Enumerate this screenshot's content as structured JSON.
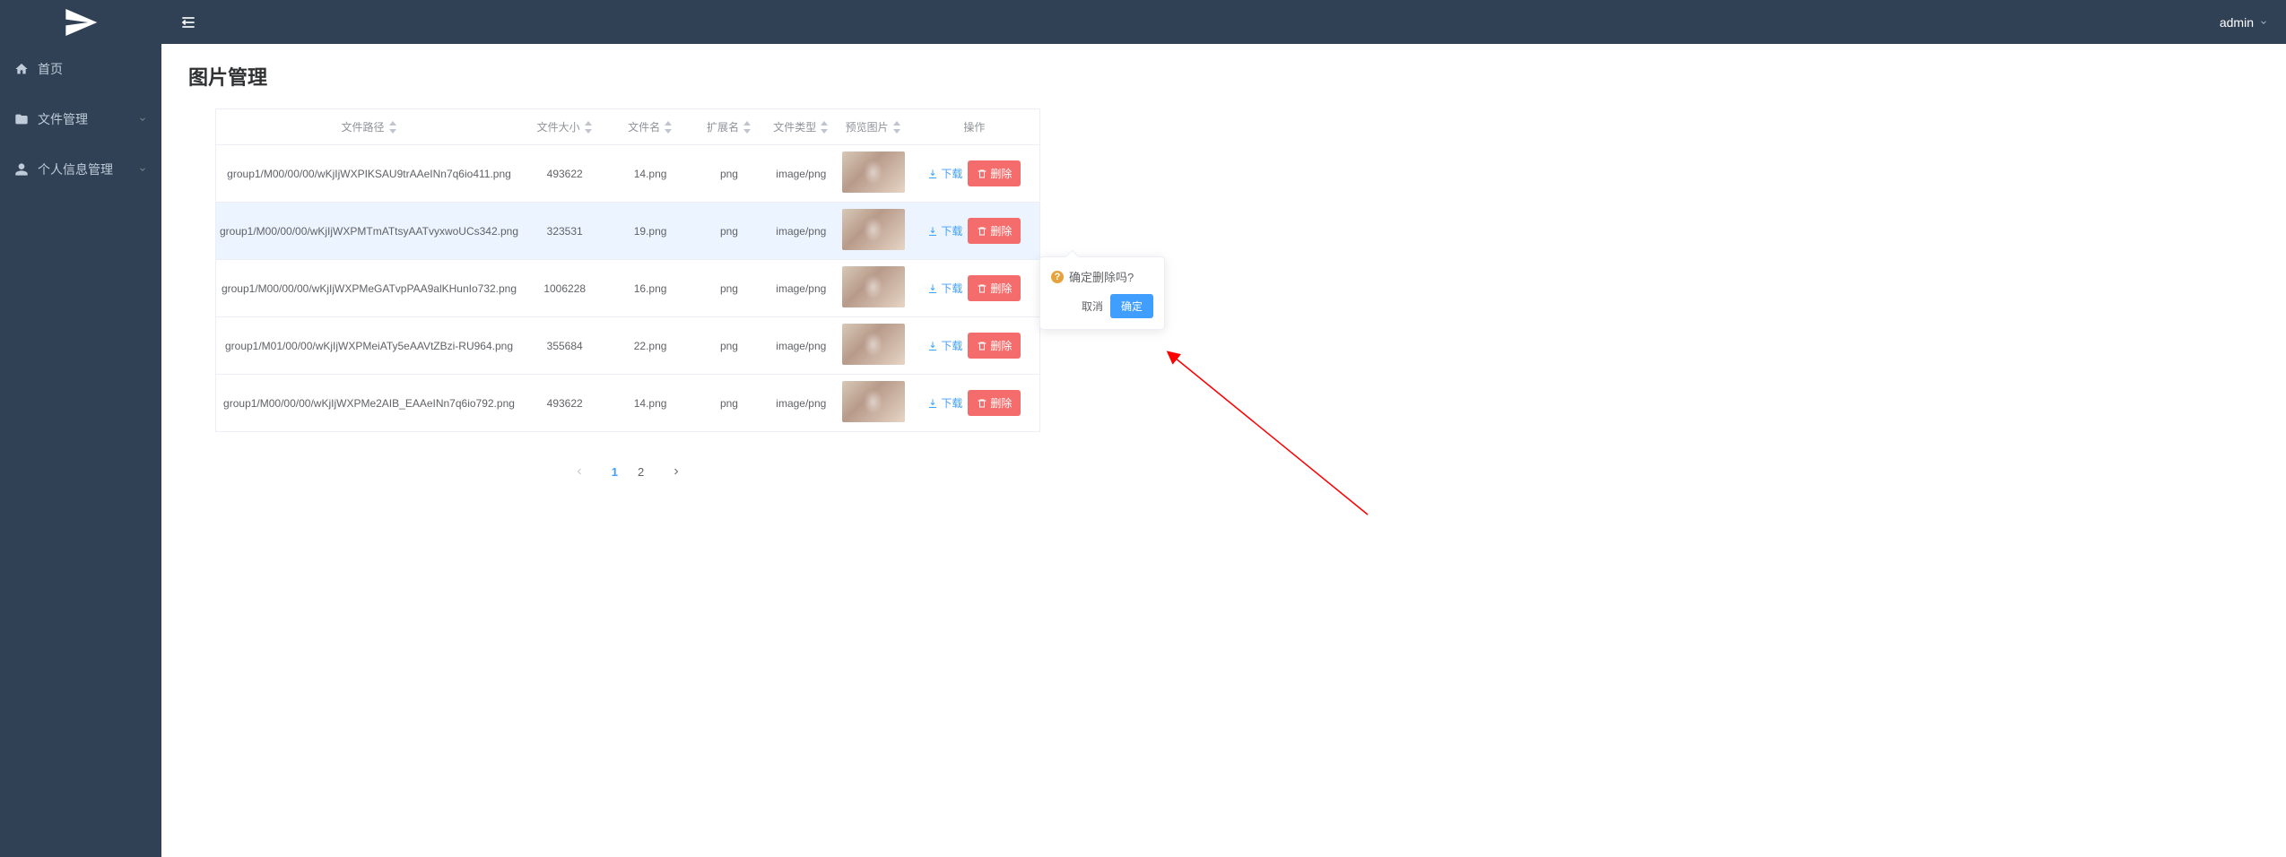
{
  "sidebar": {
    "items": [
      {
        "icon": "home-icon",
        "label": "首页",
        "expandable": false
      },
      {
        "icon": "folder-icon",
        "label": "文件管理",
        "expandable": true
      },
      {
        "icon": "user-icon",
        "label": "个人信息管理",
        "expandable": true
      }
    ]
  },
  "topbar": {
    "user": "admin"
  },
  "page": {
    "title": "图片管理"
  },
  "table": {
    "columns": {
      "path": "文件路径",
      "size": "文件大小",
      "fname": "文件名",
      "ext": "扩展名",
      "type": "文件类型",
      "preview": "预览图片",
      "action": "操作"
    },
    "actions": {
      "download": "下载",
      "delete": "删除"
    },
    "rows": [
      {
        "path": "group1/M00/00/00/wKjIjWXPIKSAU9trAAeINn7q6io411.png",
        "size": "493622",
        "fname": "14.png",
        "ext": "png",
        "type": "image/png",
        "highlight": false
      },
      {
        "path": "group1/M00/00/00/wKjIjWXPMTmATtsyAATvyxwoUCs342.png",
        "size": "323531",
        "fname": "19.png",
        "ext": "png",
        "type": "image/png",
        "highlight": true
      },
      {
        "path": "group1/M00/00/00/wKjIjWXPMeGATvpPAA9alKHunIo732.png",
        "size": "1006228",
        "fname": "16.png",
        "ext": "png",
        "type": "image/png",
        "highlight": false
      },
      {
        "path": "group1/M01/00/00/wKjIjWXPMeiATy5eAAVtZBzi-RU964.png",
        "size": "355684",
        "fname": "22.png",
        "ext": "png",
        "type": "image/png",
        "highlight": false
      },
      {
        "path": "group1/M00/00/00/wKjIjWXPMe2AIB_EAAeINn7q6io792.png",
        "size": "493622",
        "fname": "14.png",
        "ext": "png",
        "type": "image/png",
        "highlight": false
      }
    ]
  },
  "popover": {
    "message": "确定删除吗?",
    "cancel": "取消",
    "confirm": "确定"
  },
  "pagination": {
    "current": 1,
    "pages": [
      "1",
      "2"
    ]
  }
}
